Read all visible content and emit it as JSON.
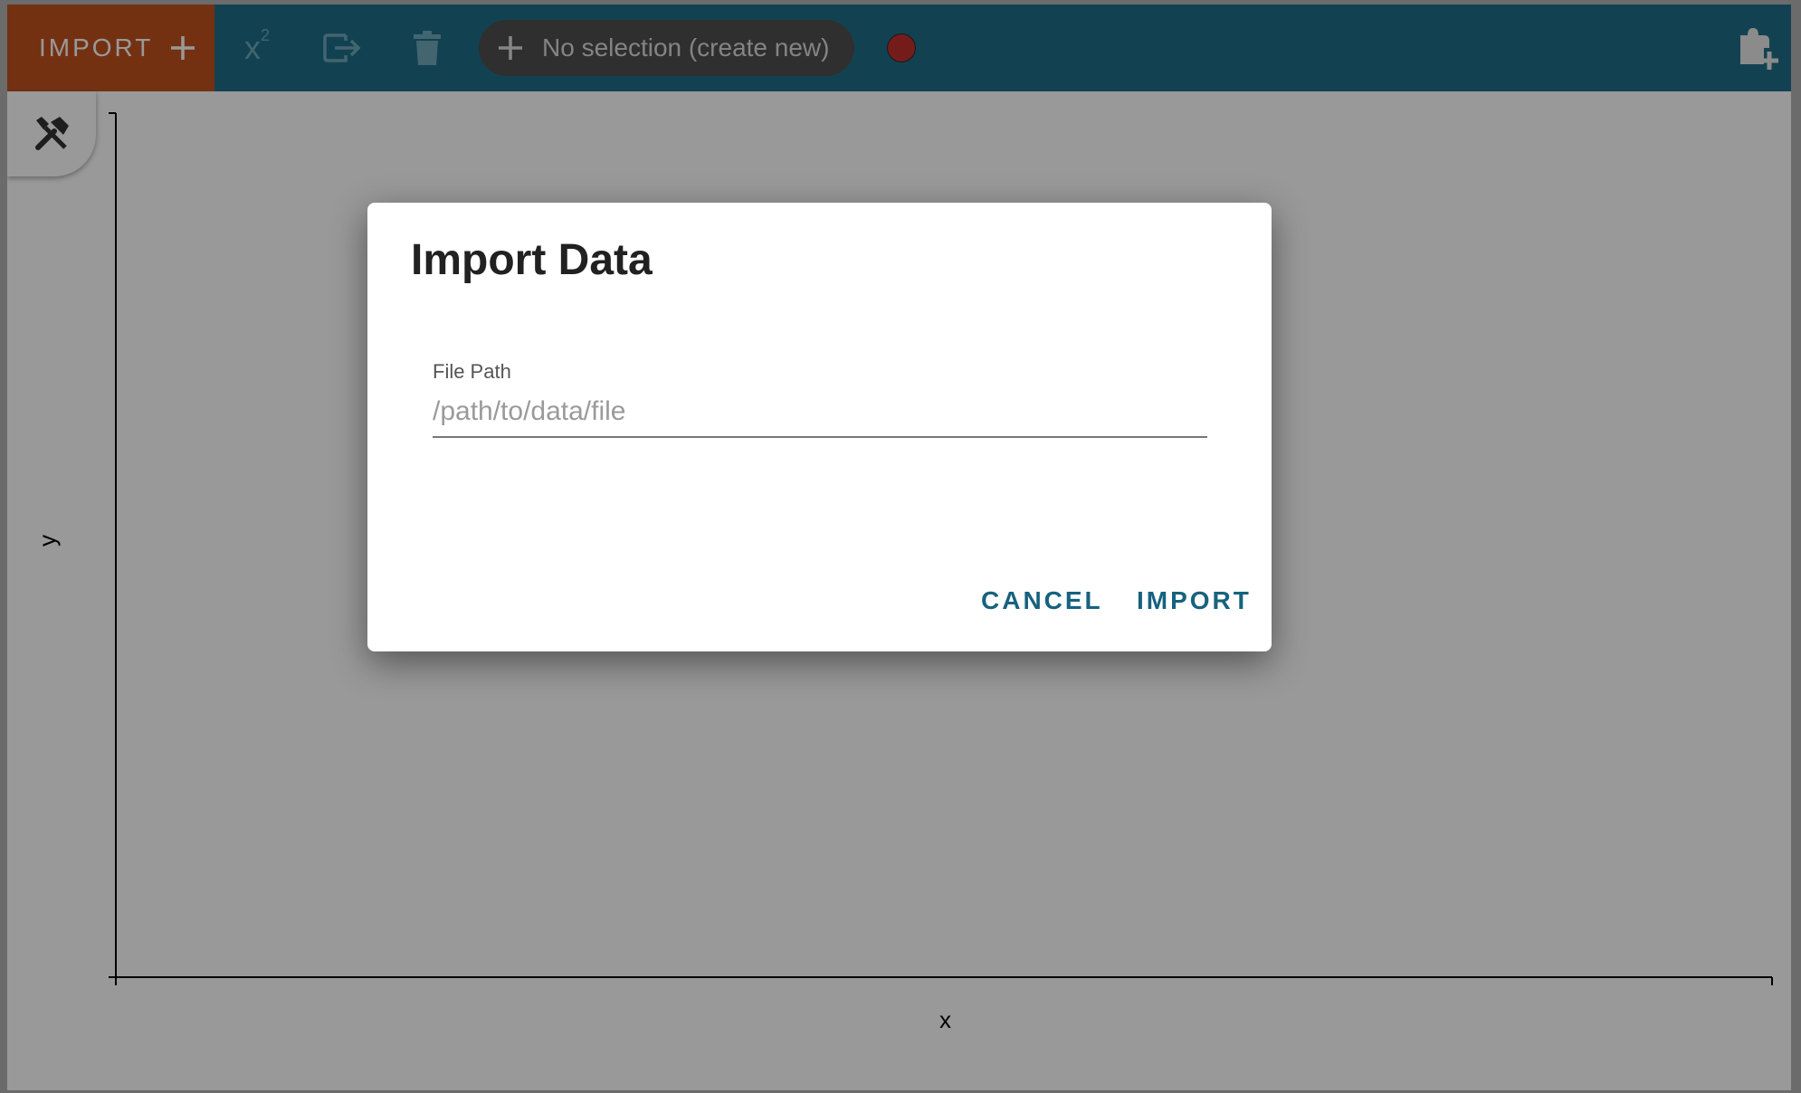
{
  "toolbar": {
    "import_label": "IMPORT",
    "x2_label": "x",
    "x2_sup": "2",
    "selector_text": "No selection (create new)"
  },
  "plot": {
    "x_axis_label": "x",
    "y_axis_label": "y"
  },
  "dialog": {
    "title": "Import Data",
    "field_label": "File Path",
    "field_placeholder": "/path/to/data/file",
    "field_value": "",
    "cancel_label": "CANCEL",
    "import_label": "IMPORT"
  },
  "colors": {
    "toolbar_bg": "#1f6f87",
    "import_bg": "#c2521f",
    "record_dot": "#c0302a",
    "dialog_button": "#17627e"
  },
  "icons": [
    "plus-icon",
    "x-squared-icon",
    "export-icon",
    "trash-icon",
    "record-icon",
    "add-panel-icon",
    "tools-icon"
  ]
}
